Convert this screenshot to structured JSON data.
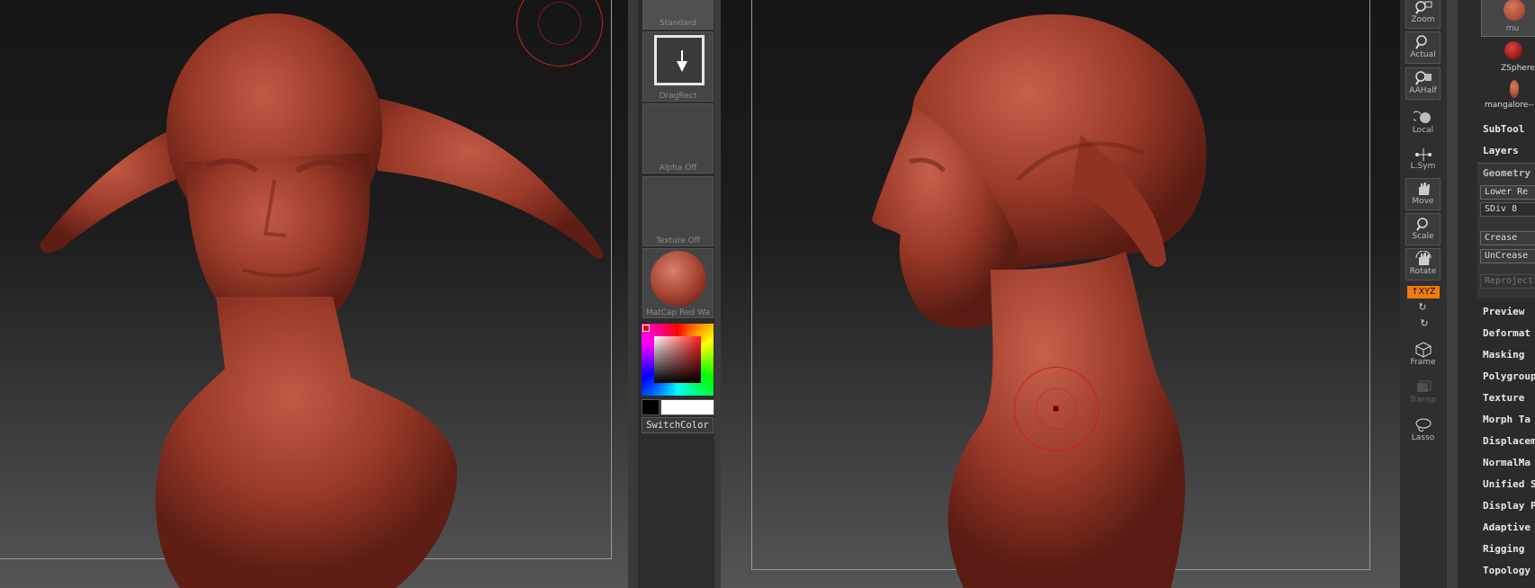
{
  "palette": {
    "brush_label": "Standard",
    "stroke_label": "DragRect",
    "alpha_label": "Alpha Off",
    "texture_label": "Texture Off",
    "material_label": "MatCap Red Wa",
    "switch_color_label": "SwitchColor"
  },
  "tools": {
    "zoom": "Zoom",
    "actual": "Actual",
    "aahalf": "AAHalf",
    "local": "Local",
    "lsym": "L.Sym",
    "move": "Move",
    "scale": "Scale",
    "rotate": "Rotate",
    "xyz": "↑XYZ",
    "frame": "Frame",
    "transp": "Transp",
    "lasso": "Lasso"
  },
  "tool_panel": {
    "thumbnails": [
      "mu",
      "ZSphere",
      "mangalore--"
    ],
    "sections": [
      "SubTool",
      "Layers"
    ],
    "geometry": {
      "title": "Geometry",
      "buttons": [
        "Lower Re",
        "SDiv 8",
        "Crease",
        "UnCrease",
        "Reproject"
      ]
    },
    "more_sections": [
      "Preview",
      "Deformat",
      "Masking",
      "Polygroup",
      "Texture",
      "Morph Ta",
      "Displacem",
      "NormalMa",
      "Unified S",
      "Display P",
      "Adaptive",
      "Rigging",
      "Topology"
    ]
  },
  "colors": {
    "accent_orange": "#f07a10",
    "brush_cursor": "#c8201f",
    "model_red": "#a3402e"
  }
}
